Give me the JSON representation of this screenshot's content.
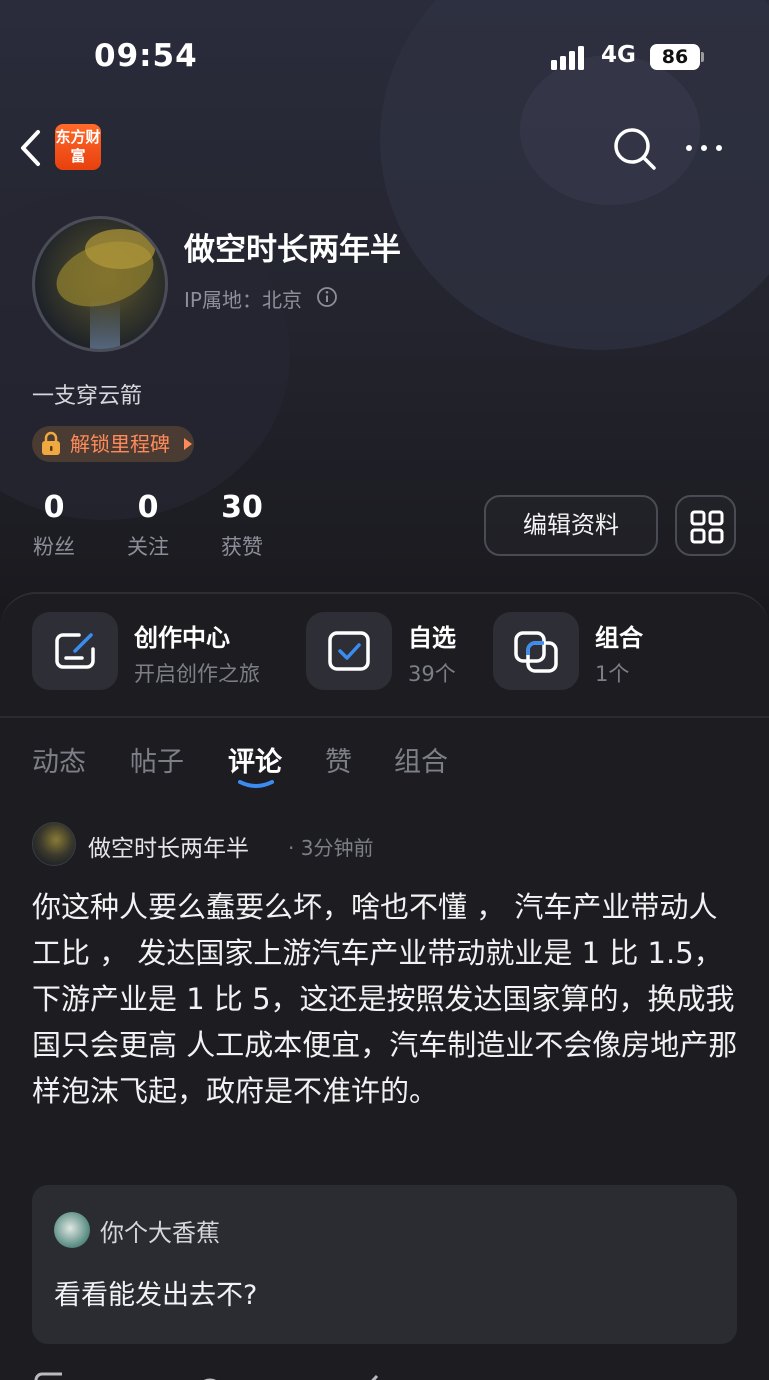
{
  "status_bar": {
    "time": "09:54",
    "network": "4G",
    "battery": "86"
  },
  "header": {
    "logo_text": "东方财富"
  },
  "profile": {
    "name": "做空时长两年半",
    "ip_location": "IP属地：北京",
    "bio": "一支穿云箭",
    "milestone_label": "解锁里程碑",
    "edit_button": "编辑资料"
  },
  "stats": [
    {
      "value": "0",
      "label": "粉丝"
    },
    {
      "value": "0",
      "label": "关注"
    },
    {
      "value": "30",
      "label": "获赞"
    }
  ],
  "cards": [
    {
      "title": "创作中心",
      "subtitle": "开启创作之旅",
      "icon": "edit-icon"
    },
    {
      "title": "自选",
      "subtitle": "39个",
      "icon": "checkbox-icon"
    },
    {
      "title": "组合",
      "subtitle": "1个",
      "icon": "portfolio-icon"
    }
  ],
  "tabs": [
    "动态",
    "帖子",
    "评论",
    "赞",
    "组合"
  ],
  "active_tab": "评论",
  "comment": {
    "author": "做空时长两年半",
    "time": "· 3分钟前",
    "text": "你这种人要么蠢要么坏，啥也不懂 ， 汽车产业带动人工比 ， 发达国家上游汽车产业带动就业是 1 比 1.5，下游产业是 1 比 5，这还是按照发达国家算的，换成我国只会更高 人工成本便宜，汽车制造业不会像房地产那样泡沫飞起，政府是不准许的。",
    "quoted": {
      "author": "你个大香蕉",
      "text": "看看能发出去不?"
    }
  },
  "colors": {
    "accent": "#ff6a2a",
    "milestone": "#ff8b5a",
    "tab_indicator": "#3a8cf0"
  }
}
